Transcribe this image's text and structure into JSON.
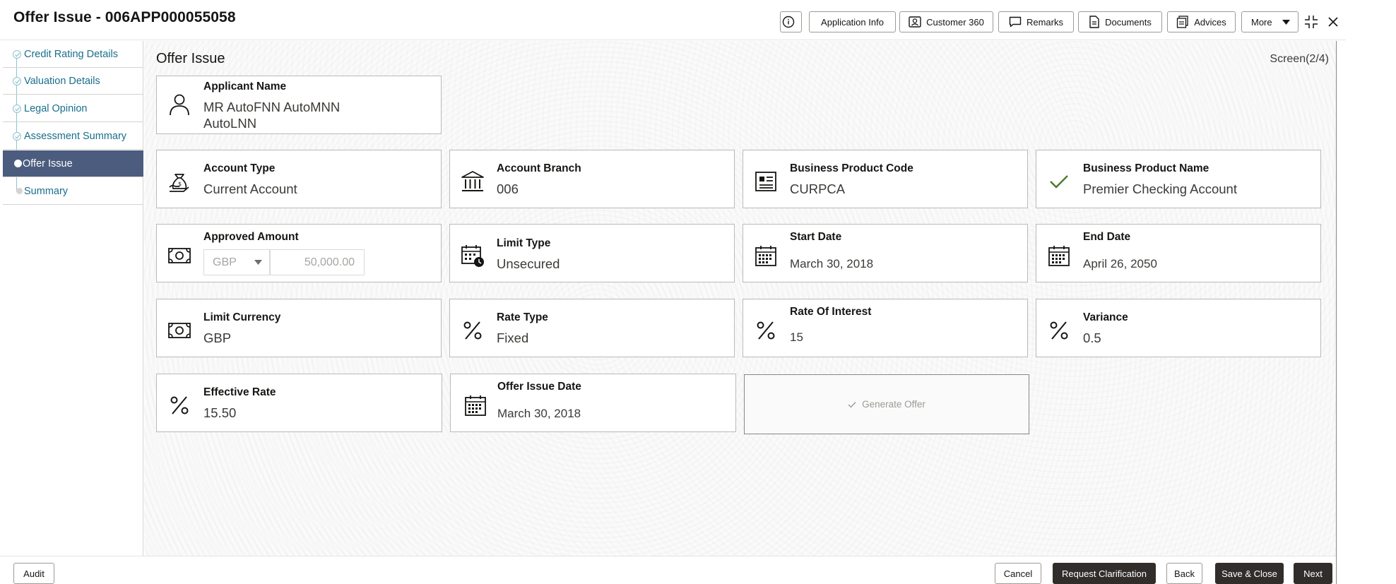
{
  "header": {
    "title": "Offer Issue - 006APP000055058",
    "buttons": {
      "application_info": "Application Info",
      "customer_360": "Customer 360",
      "remarks": "Remarks",
      "documents": "Documents",
      "advices": "Advices",
      "more": "More"
    }
  },
  "sidebar": {
    "items": [
      {
        "label": "Credit Rating Details",
        "state": "done"
      },
      {
        "label": "Valuation Details",
        "state": "done"
      },
      {
        "label": "Legal Opinion",
        "state": "done"
      },
      {
        "label": "Assessment Summary",
        "state": "done"
      },
      {
        "label": "Offer Issue",
        "state": "active"
      },
      {
        "label": "Summary",
        "state": "pending"
      }
    ]
  },
  "main": {
    "title": "Offer Issue",
    "screen_indicator": "Screen(2/4)",
    "applicant": {
      "label": "Applicant Name",
      "value_line1": "MR AutoFNN AutoMNN",
      "value_line2": "AutoLNN"
    },
    "account_type": {
      "label": "Account Type",
      "value": "Current Account"
    },
    "account_branch": {
      "label": "Account Branch",
      "value": "006"
    },
    "business_product_code": {
      "label": "Business Product Code",
      "value": "CURPCA"
    },
    "business_product_name": {
      "label": "Business Product Name",
      "value": "Premier Checking Account"
    },
    "approved_amount": {
      "label": "Approved Amount",
      "currency": "GBP",
      "amount": "50,000.00"
    },
    "limit_type": {
      "label": "Limit Type",
      "value": "Unsecured"
    },
    "start_date": {
      "label": "Start Date",
      "value": "March 30, 2018"
    },
    "end_date": {
      "label": "End Date",
      "value": "April 26, 2050"
    },
    "limit_currency": {
      "label": "Limit Currency",
      "value": "GBP"
    },
    "rate_type": {
      "label": "Rate Type",
      "value": "Fixed"
    },
    "rate_of_interest": {
      "label": "Rate Of Interest",
      "value": "15"
    },
    "variance": {
      "label": "Variance",
      "value": "0.5"
    },
    "effective_rate": {
      "label": "Effective Rate",
      "value": "15.50"
    },
    "offer_issue_date": {
      "label": "Offer Issue Date",
      "value": "March 30, 2018"
    },
    "generate_offer": "Generate Offer"
  },
  "footer": {
    "audit": "Audit",
    "cancel": "Cancel",
    "request_clarification": "Request Clarification",
    "back": "Back",
    "save_close": "Save & Close",
    "next": "Next"
  },
  "colors": {
    "accent_teal": "#1a6e8c",
    "active_step": "#4b5c7e",
    "primary_button": "#312d2a",
    "success_check": "#4a7a28"
  }
}
